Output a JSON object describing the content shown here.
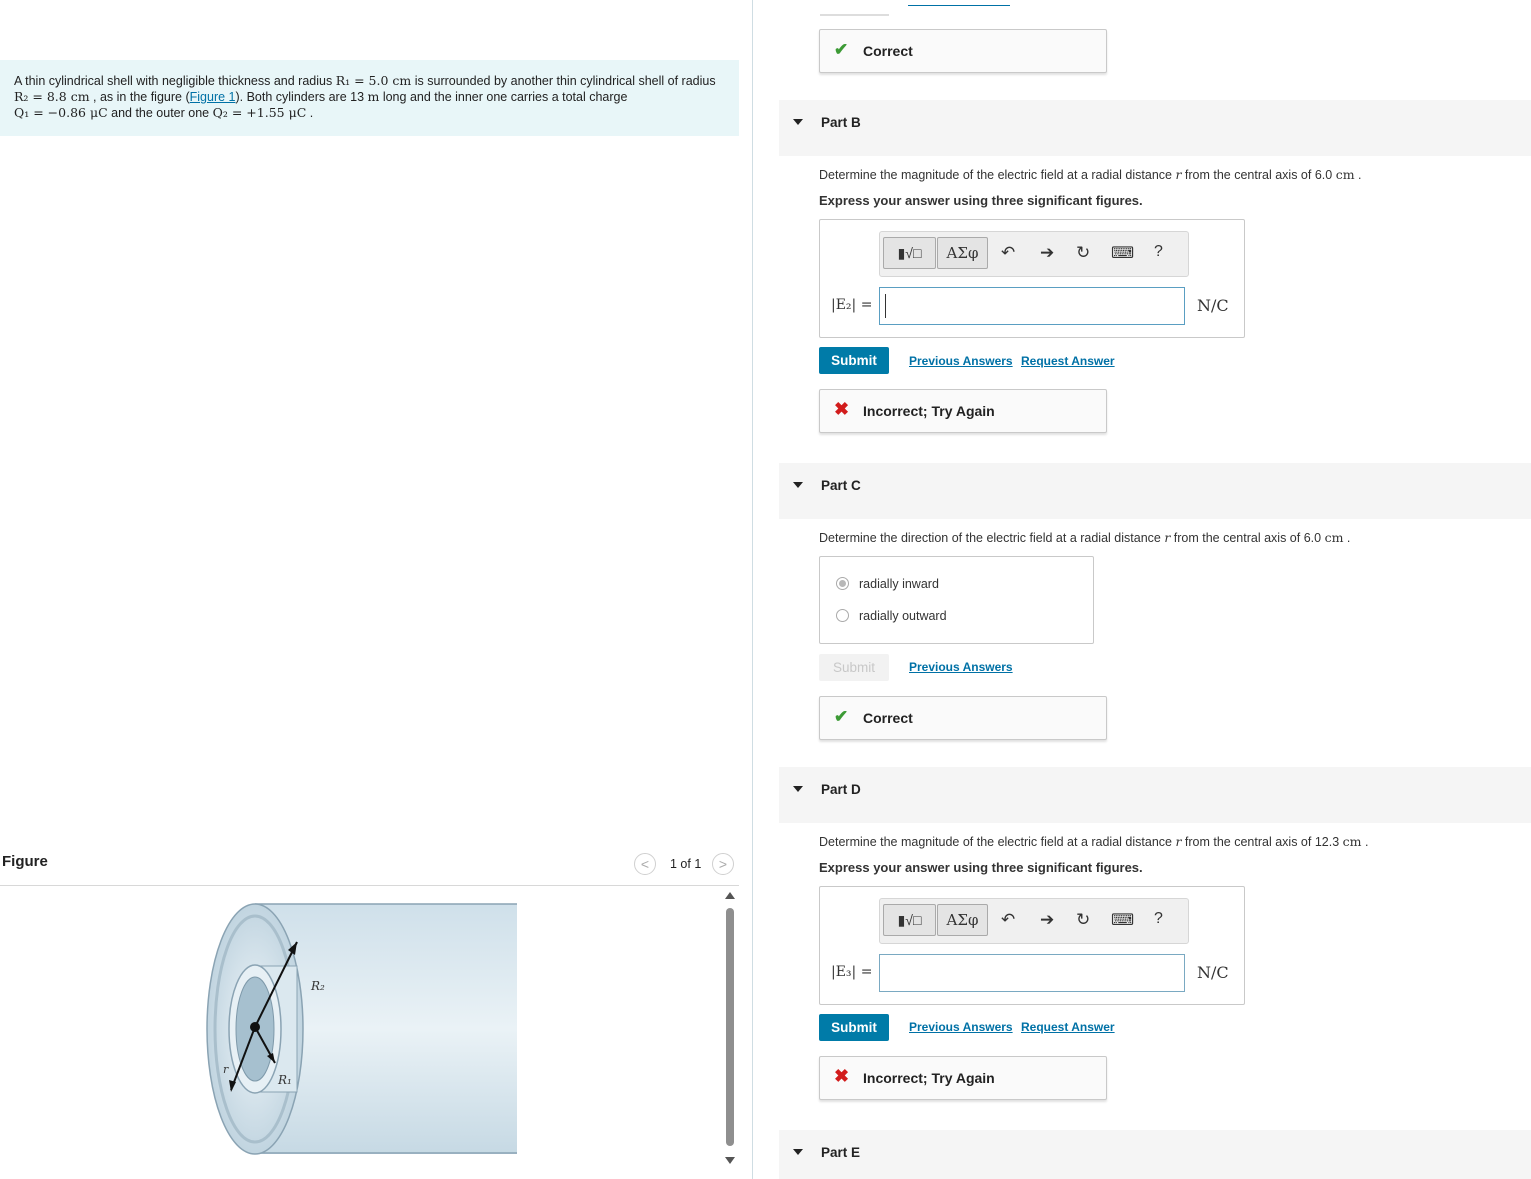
{
  "problem": {
    "t1": "A thin cylindrical shell with negligible thickness and radius ",
    "r1": "R₁ = 5.0 cm",
    "t2": " is surrounded by another thin cylindrical shell of radius ",
    "r2": "R₂ = 8.8 cm",
    "t3": " , as in the figure (",
    "fig_link": "Figure 1",
    "t4": "). Both cylinders are 13 ",
    "m_unit": "m",
    "t5": " long and the inner one carries a total charge ",
    "q1": "Q₁ = −0.86 μC",
    "t6": " and the outer one ",
    "q2": "Q₂ = +1.55 μC",
    "t7": " ."
  },
  "figure": {
    "title": "Figure",
    "count": "1 of 1",
    "prev_icon": "<",
    "next_icon": ">",
    "label_r2": "R₂",
    "label_r1": "R₁",
    "label_r": "r"
  },
  "part_a": {
    "feedback": "Correct",
    "ok_icon": "✔"
  },
  "part_b": {
    "title": "Part B",
    "prompt_pre": "Determine the magnitude of the electric field at a radial distance ",
    "r_var": "r",
    "prompt_mid": " from the central axis of 6.0 ",
    "unit_cm": "cm",
    "prompt_end": " .",
    "instruction": "Express your answer using three significant figures.",
    "lhs": "|E₂| =",
    "unit": "N/C",
    "input_value": "",
    "submit": "Submit",
    "prev_answers": "Previous Answers",
    "request_answer": "Request Answer",
    "feedback": "Incorrect; Try Again",
    "bad_icon": "✖"
  },
  "part_c": {
    "title": "Part C",
    "prompt_pre": "Determine the direction of the electric field at a radial distance ",
    "r_var": "r",
    "prompt_mid": " from the central axis of 6.0 ",
    "unit_cm": "cm",
    "prompt_end": " .",
    "options": [
      "radially inward",
      "radially outward"
    ],
    "selected": "radially inward",
    "submit": "Submit",
    "prev_answers": "Previous Answers",
    "feedback": "Correct",
    "ok_icon": "✔"
  },
  "part_d": {
    "title": "Part D",
    "prompt_pre": "Determine the magnitude of the electric field at a radial distance ",
    "r_var": "r",
    "prompt_mid": " from the central axis of 12.3 ",
    "unit_cm": "cm",
    "prompt_end": " .",
    "instruction": "Express your answer using three significant figures.",
    "lhs": "|E₃| =",
    "unit": "N/C",
    "input_value": "",
    "submit": "Submit",
    "prev_answers": "Previous Answers",
    "request_answer": "Request Answer",
    "feedback": "Incorrect; Try Again",
    "bad_icon": "✖"
  },
  "part_e": {
    "title": "Part E"
  },
  "toolbar": {
    "template_label": "▮√□",
    "greek_label": "ΑΣφ",
    "undo_icon": "↶",
    "redo_icon": "➔",
    "reset_icon": "↻",
    "keyboard_icon": "⌨",
    "help": "?"
  },
  "colors": {
    "accent": "#007ba8",
    "correct": "#3c9a35",
    "incorrect": "#d21c1c",
    "problem_bg": "#e8f6f8"
  }
}
